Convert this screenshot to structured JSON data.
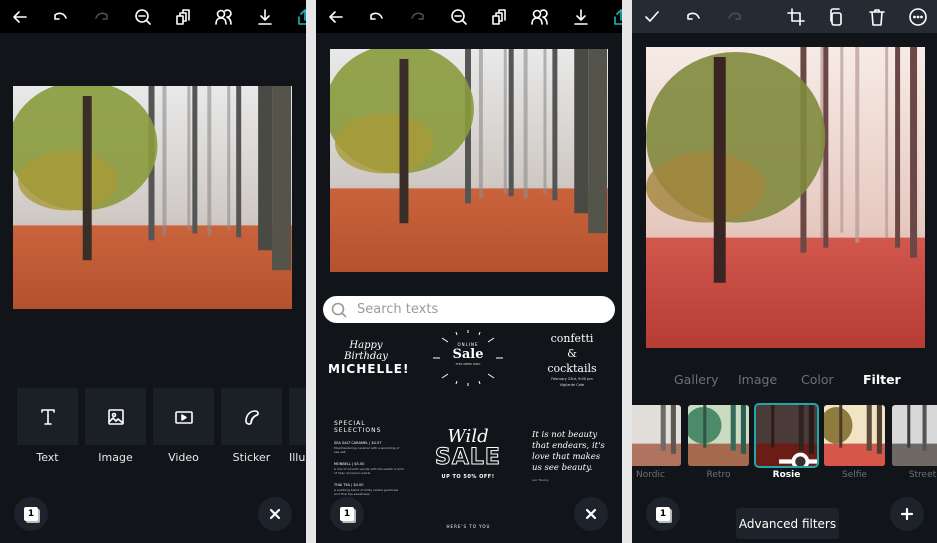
{
  "colors": {
    "background": "#11151a",
    "toolbar": "#000000",
    "toolbar_alt": "#262b33",
    "accent": "#1fb5b5",
    "tile": "#1b1f26"
  },
  "panel1": {
    "toolbar": [
      {
        "icon": "back-arrow-icon"
      },
      {
        "icon": "undo-icon"
      },
      {
        "icon": "redo-icon",
        "disabled": true
      },
      {
        "icon": "zoom-out-icon"
      },
      {
        "icon": "duplicate-pages-icon"
      },
      {
        "icon": "collaborate-icon"
      },
      {
        "icon": "download-icon"
      },
      {
        "icon": "share-icon"
      }
    ],
    "add_tiles": [
      {
        "label": "Text",
        "icon": "text-icon"
      },
      {
        "label": "Image",
        "icon": "image-icon"
      },
      {
        "label": "Video",
        "icon": "video-icon"
      },
      {
        "label": "Sticker",
        "icon": "sticker-icon"
      },
      {
        "label": "Illu",
        "icon": "illustration-icon"
      }
    ],
    "page_count": "1",
    "close_icon": "close-icon"
  },
  "panel2": {
    "search": {
      "placeholder": "Search texts",
      "value": ""
    },
    "templates": {
      "birthday": {
        "script": "Happy Birthday",
        "name": "MICHELLE!"
      },
      "sale": {
        "top": "ONLINE",
        "main": "Sale",
        "bottom": "THIS WEEK ONLY"
      },
      "confetti": {
        "line1": "confetti",
        "amp": "&",
        "line2": "cocktails",
        "date": "February 23rd, 9:00 pm",
        "venue": "Vigilante Cafe"
      },
      "special": {
        "heading": "SPECIAL SELECTIONS",
        "items": [
          {
            "name": "SEA SALT CARAMEL | $4.57",
            "desc": "Mouthwatering caramel with a sprinkling of sea salt"
          },
          {
            "name": "MONBELL | $5.00",
            "desc": "A mix of smooth vanilla with the subtle crunch of hazy cinnamon swirls"
          },
          {
            "name": "THAI TEA | $4.00",
            "desc": "A soothing blend of milky vanilla goodness and Thai tea sweetness"
          }
        ]
      },
      "wild": {
        "script": "Wild",
        "main": "SALE",
        "sub": "UP TO 50% OFF!"
      },
      "quote": {
        "text": "It is not beauty that endears, it's love that makes us see beauty.",
        "author": "Leo Tolstoy"
      },
      "here": {
        "text": "HERE'S TO YOU"
      }
    },
    "page_count": "1"
  },
  "panel3": {
    "toolbar": [
      {
        "icon": "check-icon"
      },
      {
        "icon": "undo-icon"
      },
      {
        "icon": "redo-icon",
        "disabled": true
      },
      {
        "icon": "crop-icon"
      },
      {
        "icon": "copy-icon"
      },
      {
        "icon": "trash-icon"
      },
      {
        "icon": "more-icon"
      }
    ],
    "tabs": [
      {
        "label": "Gallery",
        "active": false
      },
      {
        "label": "Image",
        "active": false
      },
      {
        "label": "Color",
        "active": false
      },
      {
        "label": "Filter",
        "active": true
      }
    ],
    "filters": [
      {
        "label": "Nordic",
        "selected": false
      },
      {
        "label": "Retro",
        "selected": false
      },
      {
        "label": "Rosie",
        "selected": true
      },
      {
        "label": "Selfie",
        "selected": false
      },
      {
        "label": "Street",
        "selected": false
      }
    ],
    "advanced_label": "Advanced filters",
    "page_count": "1"
  }
}
